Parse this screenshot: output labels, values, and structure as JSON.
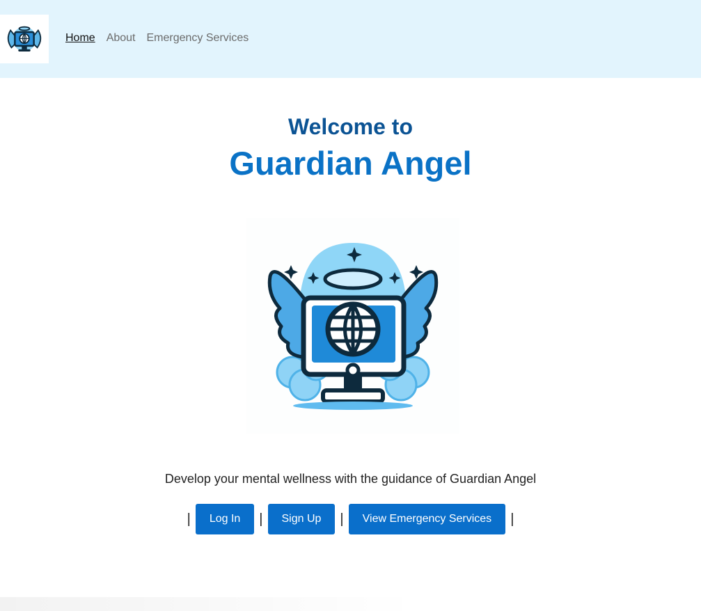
{
  "nav": {
    "logo_icon": "guardian-angel-logo-icon",
    "links": [
      {
        "label": "Home",
        "active": true
      },
      {
        "label": "About",
        "active": false
      },
      {
        "label": "Emergency Services",
        "active": false
      }
    ]
  },
  "hero": {
    "welcome": "Welcome to",
    "brand": "Guardian Angel",
    "illustration_icon": "angel-computer-globe-icon",
    "tagline": "Develop your mental wellness with the guidance of Guardian Angel"
  },
  "actions": {
    "separator": "|",
    "login_label": "Log In",
    "signup_label": "Sign Up",
    "emergency_label": "View Emergency Services"
  },
  "colors": {
    "nav_bg": "#e2f4fd",
    "welcome": "#0b5394",
    "brand": "#0a72c6",
    "button": "#0a6fcb"
  }
}
